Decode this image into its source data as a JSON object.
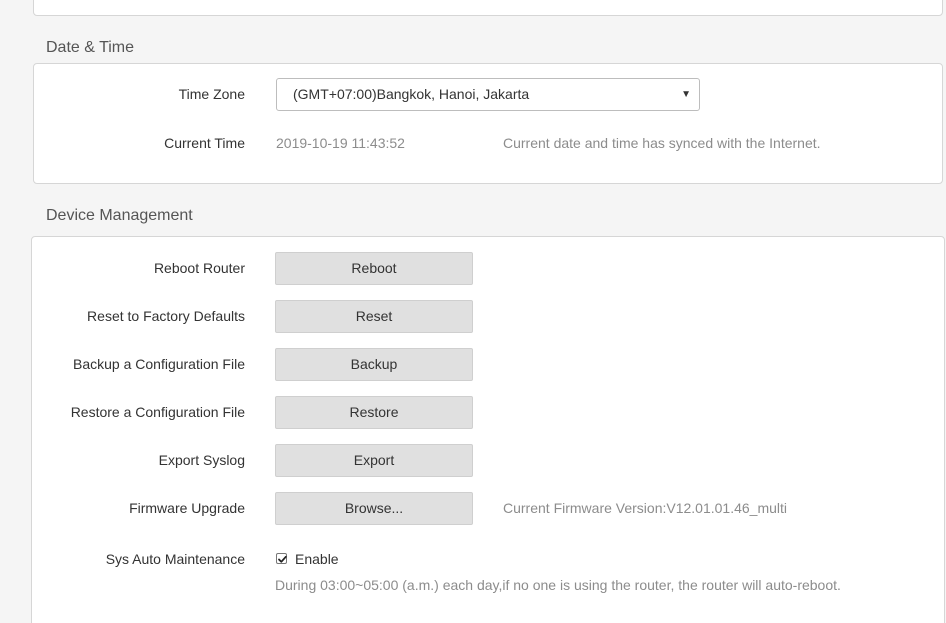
{
  "date_time": {
    "section_title": "Date & Time",
    "time_zone_label": "Time Zone",
    "time_zone_value": "(GMT+07:00)Bangkok, Hanoi, Jakarta",
    "current_time_label": "Current Time",
    "current_time_value": "2019-10-19 11:43:52",
    "sync_status": "Current date and time has synced with the Internet."
  },
  "device_management": {
    "section_title": "Device Management",
    "reboot_label": "Reboot Router",
    "reboot_button": "Reboot",
    "reset_label": "Reset to Factory Defaults",
    "reset_button": "Reset",
    "backup_label": "Backup a Configuration File",
    "backup_button": "Backup",
    "restore_label": "Restore a Configuration File",
    "restore_button": "Restore",
    "syslog_label": "Export Syslog",
    "syslog_button": "Export",
    "firmware_label": "Firmware Upgrade",
    "firmware_button": "Browse...",
    "firmware_version": "Current Firmware Version:V12.01.01.46_multi",
    "auto_maintenance_label": "Sys Auto Maintenance",
    "auto_maintenance_enabled": true,
    "auto_maintenance_option": "Enable",
    "auto_maintenance_note": "During 03:00~05:00 (a.m.) each day,if no one is using the router, the router will auto-reboot."
  }
}
